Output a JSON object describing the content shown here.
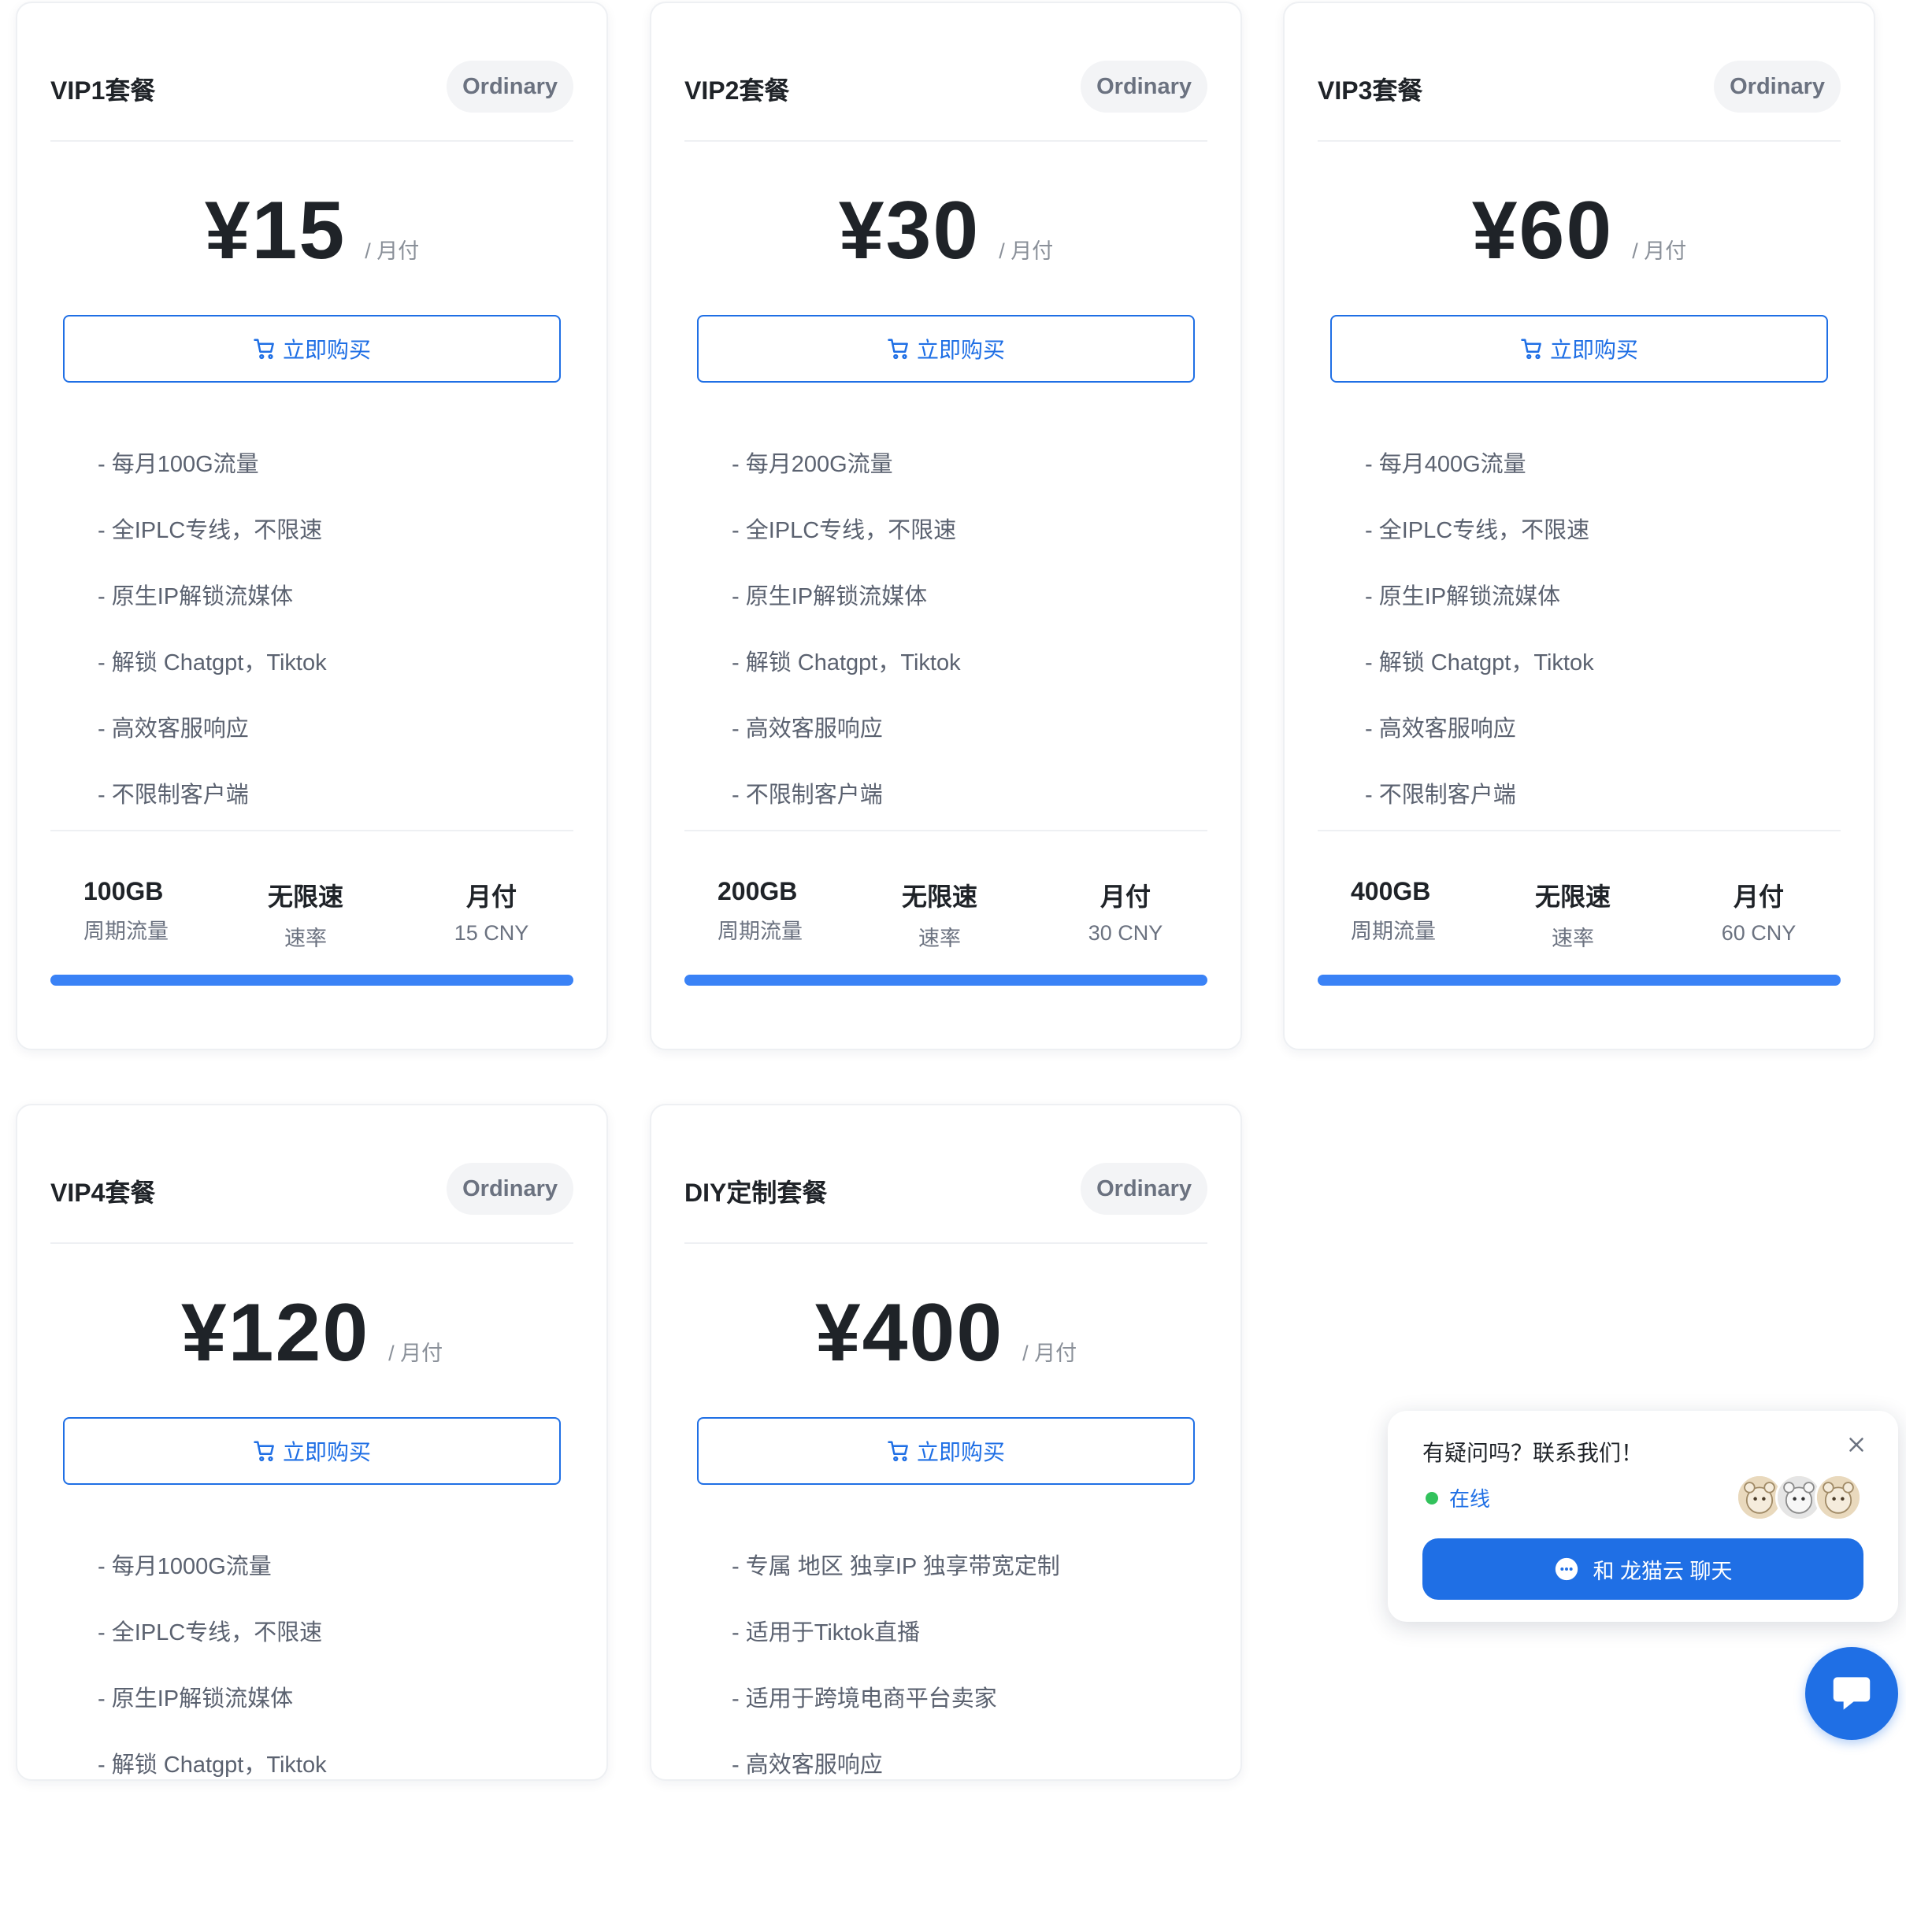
{
  "plans": [
    {
      "title": "VIP1套餐",
      "badge": "Ordinary",
      "price": "¥15",
      "period": "/ 月付",
      "buy_label": "立即购买",
      "features": [
        "- 每月100G流量",
        "- 全IPLC专线，不限速",
        "- 原生IP解锁流媒体",
        "- 解锁 Chatgpt，Tiktok",
        "- 高效客服响应",
        "- 不限制客户端"
      ],
      "stats": [
        {
          "value": "100GB",
          "label": "周期流量"
        },
        {
          "value": "无限速",
          "label": "速率"
        },
        {
          "value": "月付",
          "label": "15 CNY"
        }
      ]
    },
    {
      "title": "VIP2套餐",
      "badge": "Ordinary",
      "price": "¥30",
      "period": "/ 月付",
      "buy_label": "立即购买",
      "features": [
        "- 每月200G流量",
        "- 全IPLC专线，不限速",
        "- 原生IP解锁流媒体",
        "- 解锁 Chatgpt，Tiktok",
        "- 高效客服响应",
        "- 不限制客户端"
      ],
      "stats": [
        {
          "value": "200GB",
          "label": "周期流量"
        },
        {
          "value": "无限速",
          "label": "速率"
        },
        {
          "value": "月付",
          "label": "30 CNY"
        }
      ]
    },
    {
      "title": "VIP3套餐",
      "badge": "Ordinary",
      "price": "¥60",
      "period": "/ 月付",
      "buy_label": "立即购买",
      "features": [
        "- 每月400G流量",
        "- 全IPLC专线，不限速",
        "- 原生IP解锁流媒体",
        "- 解锁 Chatgpt，Tiktok",
        "- 高效客服响应",
        "- 不限制客户端"
      ],
      "stats": [
        {
          "value": "400GB",
          "label": "周期流量"
        },
        {
          "value": "无限速",
          "label": "速率"
        },
        {
          "value": "月付",
          "label": "60 CNY"
        }
      ]
    },
    {
      "title": "VIP4套餐",
      "badge": "Ordinary",
      "price": "¥120",
      "period": "/ 月付",
      "buy_label": "立即购买",
      "features": [
        "- 每月1000G流量",
        "- 全IPLC专线，不限速",
        "- 原生IP解锁流媒体",
        "- 解锁 Chatgpt，Tiktok"
      ]
    },
    {
      "title": "DIY定制套餐",
      "badge": "Ordinary",
      "price": "¥400",
      "period": "/ 月付",
      "buy_label": "立即购买",
      "features": [
        "- 专属 地区 独享IP 独享带宽定制",
        "- 适用于Tiktok直播",
        "- 适用于跨境电商平台卖家",
        "- 高效客服响应"
      ]
    }
  ],
  "chat": {
    "question": "有疑问吗？联系我们！",
    "status": "在线",
    "button_label": "和 龙猫云 聊天",
    "status_color": "#32c25c",
    "accent": "#1f6fe5"
  },
  "colors": {
    "accent": "#1f6fe5",
    "bar": "#3a82f6",
    "badge_bg": "#f3f4f6"
  }
}
